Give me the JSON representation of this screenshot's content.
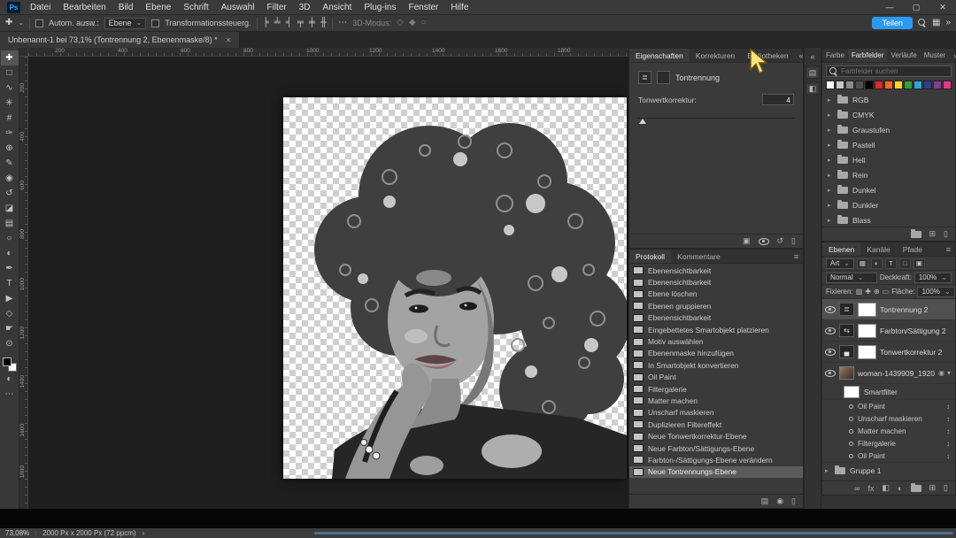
{
  "app": {
    "logo": "Ps"
  },
  "colors": {
    "accent": "#2b9af3",
    "selection": "#505050",
    "scrollbar": "#4d6f90"
  },
  "window_controls": {
    "minimize": "—",
    "maximize": "▢",
    "close": "✕"
  },
  "menubar": [
    "Datei",
    "Bearbeiten",
    "Bild",
    "Ebene",
    "Schrift",
    "Auswahl",
    "Filter",
    "3D",
    "Ansicht",
    "Plug-ins",
    "Fenster",
    "Hilfe"
  ],
  "options_bar": {
    "auto_select_label": "Autom. ausw.:",
    "auto_select_value": "Ebene",
    "transform_label": "Transformationssteuerg.",
    "mode_label": "3D-Modus:",
    "share_button": "Teilen"
  },
  "document_tab": {
    "title": "Unbenannt-1 bei 73,1% (Tontrennung 2, Ebenenmaske/8) *",
    "close": "✕"
  },
  "ruler_marks": [
    "200",
    "400",
    "600",
    "800",
    "1000",
    "1200",
    "1400",
    "1600",
    "1800"
  ],
  "tools": [
    {
      "name": "move",
      "glyph": "✚"
    },
    {
      "name": "marquee",
      "glyph": "□"
    },
    {
      "name": "lasso",
      "glyph": "∿"
    },
    {
      "name": "quick-selection",
      "glyph": "✳"
    },
    {
      "name": "crop",
      "glyph": "#"
    },
    {
      "name": "eyedropper",
      "glyph": "✑"
    },
    {
      "name": "healing-brush",
      "glyph": "⊕"
    },
    {
      "name": "brush",
      "glyph": "✎"
    },
    {
      "name": "clone-stamp",
      "glyph": "◉"
    },
    {
      "name": "history-brush",
      "glyph": "↺"
    },
    {
      "name": "eraser",
      "glyph": "◪"
    },
    {
      "name": "gradient",
      "glyph": "▤"
    },
    {
      "name": "blur",
      "glyph": "○"
    },
    {
      "name": "dodge",
      "glyph": "◐"
    },
    {
      "name": "pen",
      "glyph": "✒"
    },
    {
      "name": "type",
      "glyph": "T"
    },
    {
      "name": "path-selection",
      "glyph": "▶"
    },
    {
      "name": "shape",
      "glyph": "◇"
    },
    {
      "name": "hand",
      "glyph": "☛"
    },
    {
      "name": "zoom",
      "glyph": "⊙"
    },
    {
      "name": "edit-toolbar",
      "glyph": "⋯"
    }
  ],
  "properties_panel": {
    "tabs": [
      "Eigenschaften",
      "Korrekturen",
      "Bibliotheken"
    ],
    "adjustment_title": "Tontrennung",
    "levels_label": "Tonwertkorrektur:",
    "levels_value": "4"
  },
  "history_panel": {
    "tabs": [
      "Protokoll",
      "Kommentare"
    ],
    "items": [
      "Ebenensichtbarkeit",
      "Ebenensichtbarkeit",
      "Ebene löschen",
      "Ebenen gruppieren",
      "Ebenensichtbarkeit",
      "Eingebettetes Smartobjekt platzieren",
      "Motiv auswählen",
      "Ebenenmaske hinzufügen",
      "In Smartobjekt konvertieren",
      "Oil Paint",
      "Filtergalerie",
      "Matter machen",
      "Unscharf maskieren",
      "Duplizieren Filtereffekt",
      "Neue Tonwertkorrektur-Ebene",
      "Neue Farbton/Sättigungs-Ebene",
      "Farbton-/Sättigungs-Ebene verändern",
      "Neue Tontrennungs-Ebene"
    ]
  },
  "swatches_panel": {
    "tabs": [
      "Farbe",
      "Farbfelder",
      "Verläufe",
      "Muster"
    ],
    "search_placeholder": "Farbfelder suchen",
    "swatches": [
      "#ffffff",
      "#c6c6c6",
      "#8b8b8b",
      "#4f4f4f",
      "#000000",
      "#e0262b",
      "#f26722",
      "#ffd22b",
      "#33a13a",
      "#29a8dc",
      "#2f3b97",
      "#7d3f98",
      "#e5368c"
    ],
    "groups": [
      "RGB",
      "CMYK",
      "Graustufen",
      "Pastell",
      "Hell",
      "Rein",
      "Dunkel",
      "Dunkler",
      "Blass"
    ]
  },
  "layers_panel": {
    "tabs": [
      "Ebenen",
      "Kanäle",
      "Pfade"
    ],
    "filter_label": "Art",
    "blend_mode": "Normal",
    "opacity_label": "Deckkraft:",
    "opacity_value": "100%",
    "lock_label": "Fixieren:",
    "fill_label": "Fläche:",
    "fill_value": "100%",
    "layers": {
      "tontrennung": "Tontrennung 2",
      "farbton": "Farbton/Sättigung 2",
      "tonwert": "Tonwertkorrektur 2",
      "woman": "woman-1439909_1920",
      "smartfilter": "Smartfilter",
      "group": "Gruppe 1"
    },
    "filters": [
      "Oil Paint",
      "Unscharf maskieren",
      "Matter machen",
      "Filtergalerie",
      "Oil Paint"
    ]
  },
  "status_bar": {
    "zoom": "73,08%",
    "doc_info": "2000 Px x 2000 Px (72 ppcm)",
    "chevron": "›"
  },
  "icons": {
    "caret_down": "⌄",
    "chevrons_right": "»",
    "chevrons_left": "«",
    "panel_menu": "≡",
    "ellipsis": "⋯",
    "grid": "▦",
    "align": [
      "╞",
      "╧",
      "╡",
      "╤",
      "╪",
      "╫"
    ],
    "mode3d": [
      "◇",
      "◆",
      "○"
    ],
    "posterize": "≣",
    "huesat": "⇆",
    "levels": "▄",
    "clip": "▣",
    "reset": "↺",
    "trash": "▯",
    "doc_new": "▤",
    "camera": "◉",
    "plus": "⊞",
    "link": "∞",
    "fx": "fx",
    "mask": "◧",
    "adjust": "◐",
    "updown": "↕",
    "expand": "▾",
    "collapsed": "▸",
    "filter_types": [
      "▦",
      "◐",
      "T",
      "□",
      "▣"
    ],
    "locks": [
      "▨",
      "✚",
      "⊕",
      "▭"
    ]
  }
}
